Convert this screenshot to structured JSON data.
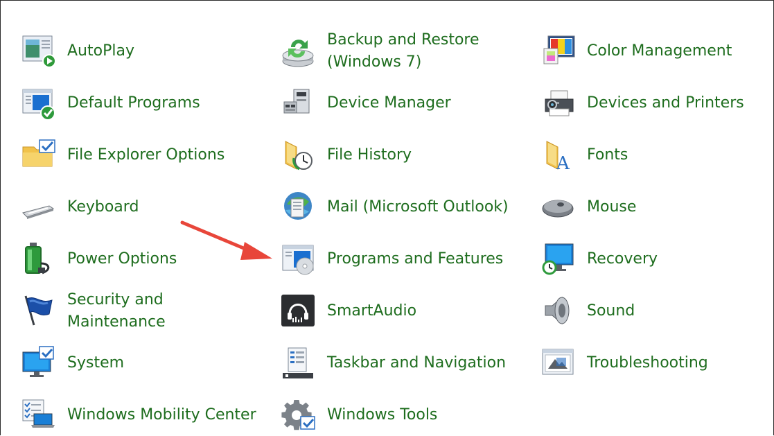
{
  "items": [
    {
      "label": "AutoPlay",
      "icon": "autoplay-icon"
    },
    {
      "label": "Backup and Restore\n(Windows 7)",
      "icon": "backup-restore-icon"
    },
    {
      "label": "Color Management",
      "icon": "color-management-icon"
    },
    {
      "label": "Default Programs",
      "icon": "default-programs-icon"
    },
    {
      "label": "Device Manager",
      "icon": "device-manager-icon"
    },
    {
      "label": "Devices and Printers",
      "icon": "printer-icon"
    },
    {
      "label": "File Explorer Options",
      "icon": "folder-options-icon"
    },
    {
      "label": "File History",
      "icon": "file-history-icon"
    },
    {
      "label": "Fonts",
      "icon": "fonts-icon"
    },
    {
      "label": "Keyboard",
      "icon": "keyboard-icon"
    },
    {
      "label": "Mail (Microsoft Outlook)",
      "icon": "mail-icon"
    },
    {
      "label": "Mouse",
      "icon": "mouse-icon"
    },
    {
      "label": "Power Options",
      "icon": "battery-icon"
    },
    {
      "label": "Programs and Features",
      "icon": "programs-features-icon"
    },
    {
      "label": "Recovery",
      "icon": "recovery-icon"
    },
    {
      "label": "Security and Maintenance",
      "icon": "flag-icon"
    },
    {
      "label": "SmartAudio",
      "icon": "headphones-icon"
    },
    {
      "label": "Sound",
      "icon": "speaker-icon"
    },
    {
      "label": "System",
      "icon": "monitor-check-icon"
    },
    {
      "label": "Taskbar and Navigation",
      "icon": "taskbar-icon"
    },
    {
      "label": "Troubleshooting",
      "icon": "troubleshooting-icon"
    },
    {
      "label": "Windows Mobility Center",
      "icon": "mobility-center-icon"
    },
    {
      "label": "Windows Tools",
      "icon": "gear-icon"
    }
  ],
  "colors": {
    "link_text": "#1e6d1e",
    "arrow": "#e8463a",
    "background": "#ffffff"
  }
}
